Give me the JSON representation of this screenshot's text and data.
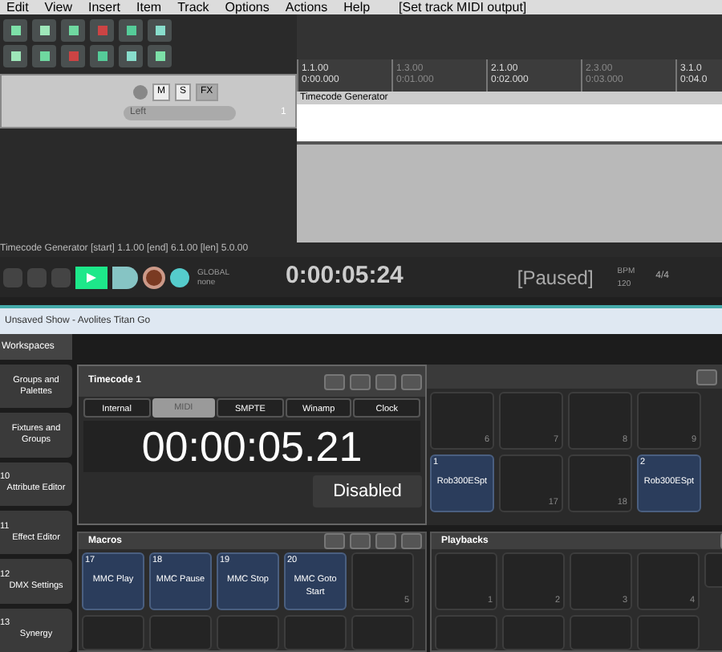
{
  "daw": {
    "menu": [
      "Edit",
      "View",
      "Insert",
      "Item",
      "Track",
      "Options",
      "Actions",
      "Help"
    ],
    "menu_hint": "[Set track MIDI output]",
    "track": {
      "mute": "M",
      "solo": "S",
      "fx": "FX",
      "input": "Left",
      "number": "1"
    },
    "ruler": [
      {
        "bar": "1.1.00",
        "time": "0:00.000"
      },
      {
        "bar": "1.3.00",
        "time": "0:01.000"
      },
      {
        "bar": "2.1.00",
        "time": "0:02.000"
      },
      {
        "bar": "2.3.00",
        "time": "0:03.000"
      },
      {
        "bar": "3.1.0",
        "time": "0:04.0"
      }
    ],
    "item": "Timecode Generator",
    "status": "Timecode Generator [start] 1.1.00 [end] 6.1.00 [len] 5.0.00",
    "transport": {
      "global": "GLOBAL",
      "mode": "none",
      "time": "0:00:05:24",
      "state": "[Paused]",
      "bpm_label": "BPM",
      "bpm": "120",
      "signature": "4/4"
    }
  },
  "titan": {
    "title": "Unsaved Show - Avolites Titan Go",
    "workspaces": "Workspaces",
    "sidebar": [
      {
        "label": "Groups and Palettes"
      },
      {
        "label": "Fixtures and Groups"
      },
      {
        "number": "10",
        "label": "Attribute Editor"
      },
      {
        "number": "11",
        "label": "Effect Editor"
      },
      {
        "number": "12",
        "label": "DMX Settings"
      },
      {
        "number": "13",
        "label": "Synergy"
      }
    ],
    "timecode": {
      "title": "Timecode 1",
      "tabs": [
        {
          "label": "Internal",
          "selected": false
        },
        {
          "label": "MIDI",
          "selected": true
        },
        {
          "label": "SMPTE",
          "selected": false
        },
        {
          "label": "Winamp",
          "selected": false
        },
        {
          "label": "Clock",
          "selected": false
        }
      ],
      "time": "00:00:05.21",
      "button": "Disabled"
    },
    "fixtures": [
      {
        "index": "6"
      },
      {
        "index": "7"
      },
      {
        "index": "8"
      },
      {
        "index": "9"
      },
      {
        "number": "1",
        "label": "Rob300ESpt"
      },
      {
        "index": "17"
      },
      {
        "index": "18"
      },
      {
        "number": "2",
        "label": "Rob300ESpt"
      }
    ],
    "macros": {
      "title": "Macros",
      "cells": [
        {
          "number": "17",
          "label": "MMC Play"
        },
        {
          "number": "18",
          "label": "MMC Pause"
        },
        {
          "number": "19",
          "label": "MMC Stop"
        },
        {
          "number": "20",
          "label": "MMC Goto Start"
        },
        {
          "index": "5"
        }
      ]
    },
    "playbacks": {
      "title": "Playbacks",
      "cells": [
        {
          "index": "1"
        },
        {
          "index": "2"
        },
        {
          "index": "3"
        },
        {
          "index": "4"
        }
      ]
    }
  }
}
